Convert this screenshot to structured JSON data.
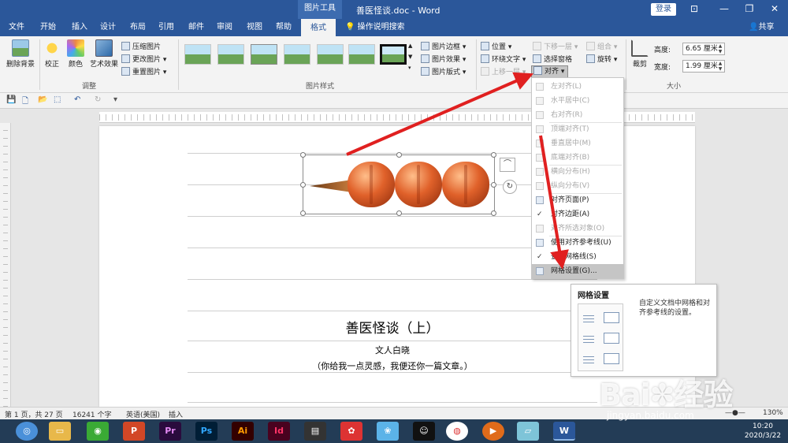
{
  "titlebar": {
    "context_label": "图片工具",
    "title": "善医怪谈.doc - Word",
    "login": "登录",
    "min": "—",
    "restore": "❐",
    "close": "✕",
    "ribbon_opt": "⊡"
  },
  "tabs": [
    "文件",
    "开始",
    "插入",
    "设计",
    "布局",
    "引用",
    "邮件",
    "审阅",
    "视图",
    "帮助",
    "格式"
  ],
  "tellme": "操作说明搜索",
  "share": "共享",
  "ribbon": {
    "remove_bg": "删除背景",
    "correct": "校正",
    "color": "颜色",
    "art_effect": "艺术效果",
    "compress": "压缩图片",
    "change_pic": "更改图片",
    "reset_pic": "重置图片",
    "group_adjust": "调整",
    "pic_border": "图片边框",
    "pic_effect": "图片效果",
    "pic_layout": "图片版式",
    "group_styles": "图片样式",
    "position": "位置",
    "wrap": "环绕文字",
    "bring_fwd": "上移一层",
    "send_back": "下移一层",
    "sel_pane": "选择窗格",
    "align": "对齐",
    "group": "组合",
    "rotate": "旋转",
    "crop": "裁剪",
    "height_label": "高度:",
    "height_val": "6.65 厘米",
    "width_label": "宽度:",
    "width_val": "1.99 厘米",
    "group_size": "大小"
  },
  "menu": {
    "items": [
      {
        "label": "左对齐(L)",
        "state": "disabled"
      },
      {
        "label": "水平居中(C)",
        "state": "disabled"
      },
      {
        "label": "右对齐(R)",
        "state": "disabled"
      },
      {
        "label": "顶端对齐(T)",
        "state": "disabled"
      },
      {
        "label": "垂直居中(M)",
        "state": "disabled"
      },
      {
        "label": "底端对齐(B)",
        "state": "disabled"
      },
      {
        "label": "横向分布(H)",
        "state": "disabled"
      },
      {
        "label": "纵向分布(V)",
        "state": "disabled"
      },
      {
        "label": "对齐页面(P)",
        "state": "normal"
      },
      {
        "label": "对齐边距(A)",
        "state": "checked"
      },
      {
        "label": "对齐所选对象(O)",
        "state": "disabled"
      },
      {
        "label": "使用对齐参考线(U)",
        "state": "normal"
      },
      {
        "label": "查看网格线(S)",
        "state": "checked"
      },
      {
        "label": "网格设置(G)...",
        "state": "highlight"
      }
    ]
  },
  "tooltip": {
    "title": "网格设置",
    "desc": "自定义文档中网格和对齐参考线的设置。"
  },
  "doc": {
    "title": "善医怪谈（上）",
    "author": "文人白晓",
    "subtitle": "（你给我一点灵感，我便还你一篇文章。）"
  },
  "status": {
    "page": "第 1 页，共 27 页",
    "words": "16241 个字",
    "lang": "英语(美国)",
    "mode": "插入",
    "zoom": "130%"
  },
  "taskbar": {
    "apps": [
      "Pr",
      "Ps",
      "Ai",
      "Id",
      "W"
    ],
    "time": "10:20",
    "date": "2020/3/22"
  },
  "watermark": {
    "brand": "Bai",
    "brand2": "经验",
    "url": "jingyan.baidu.com"
  },
  "colors": {
    "accent": "#2b579a",
    "arrow": "#e02020"
  }
}
